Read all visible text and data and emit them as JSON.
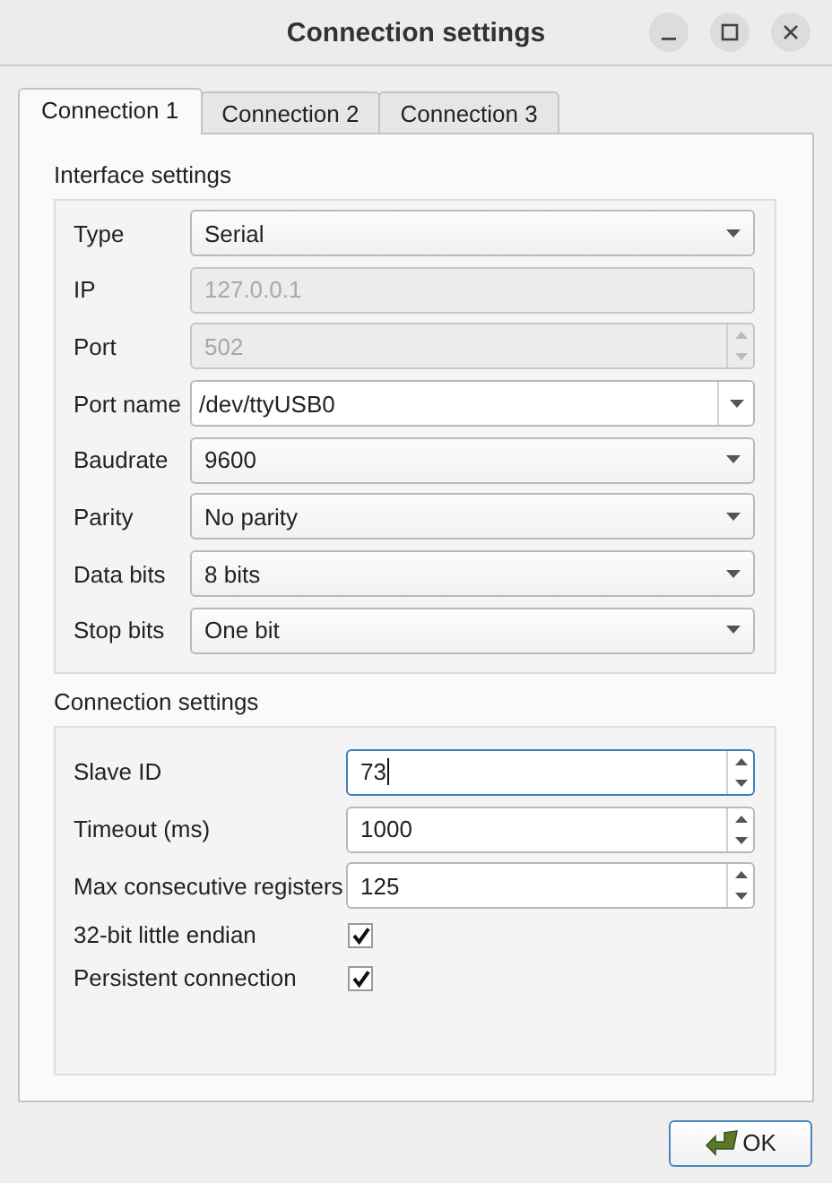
{
  "window": {
    "title": "Connection settings"
  },
  "tabs": [
    {
      "label": "Connection 1",
      "selected": true
    },
    {
      "label": "Connection 2",
      "selected": false
    },
    {
      "label": "Connection 3",
      "selected": false
    }
  ],
  "interface_settings": {
    "title": "Interface settings",
    "fields": [
      {
        "label": "Type",
        "kind": "combo",
        "value": "Serial",
        "disabled": false
      },
      {
        "label": "IP",
        "kind": "text",
        "value": "127.0.0.1",
        "disabled": true
      },
      {
        "label": "Port",
        "kind": "spin",
        "value": "502",
        "disabled": true
      },
      {
        "label": "Port name",
        "kind": "editable_combo",
        "value": "/dev/ttyUSB0",
        "disabled": false
      },
      {
        "label": "Baudrate",
        "kind": "combo",
        "value": "9600",
        "disabled": false
      },
      {
        "label": "Parity",
        "kind": "combo",
        "value": "No parity",
        "disabled": false
      },
      {
        "label": "Data bits",
        "kind": "combo",
        "value": "8 bits",
        "disabled": false
      },
      {
        "label": "Stop bits",
        "kind": "combo",
        "value": "One bit",
        "disabled": false
      }
    ]
  },
  "connection_settings": {
    "title": "Connection settings",
    "fields": [
      {
        "label": "Slave ID",
        "kind": "spin",
        "value": "73",
        "focused": true
      },
      {
        "label": "Timeout (ms)",
        "kind": "spin",
        "value": "1000",
        "focused": false
      },
      {
        "label": "Max consecutive registers",
        "kind": "spin",
        "value": "125",
        "focused": false
      },
      {
        "label": "32-bit little endian",
        "kind": "checkbox",
        "checked": true
      },
      {
        "label": "Persistent connection",
        "kind": "checkbox",
        "checked": true
      }
    ]
  },
  "buttons": [
    {
      "label": "OK"
    }
  ]
}
